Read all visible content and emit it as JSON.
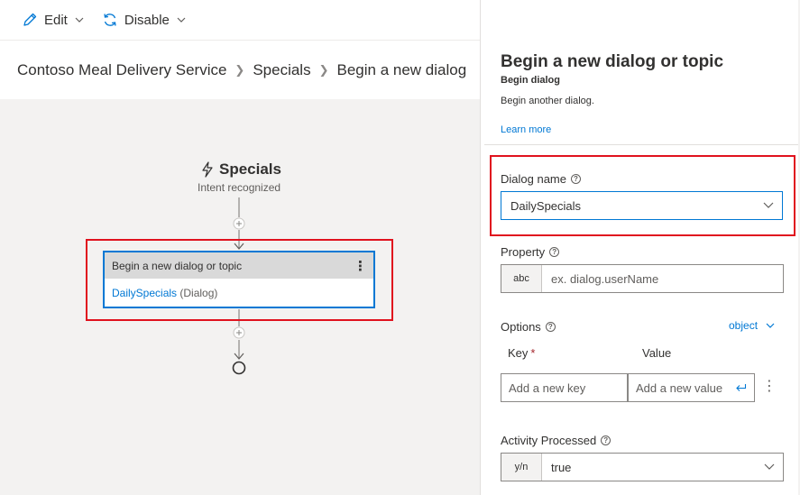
{
  "toolbar": {
    "edit_label": "Edit",
    "disable_label": "Disable"
  },
  "breadcrumb": [
    "Contoso Meal Delivery Service",
    "Specials",
    "Begin a new dialog"
  ],
  "canvas": {
    "trigger": {
      "title": "Specials",
      "subtitle": "Intent recognized"
    },
    "node": {
      "title": "Begin a new dialog or topic",
      "dialog_link": "DailySpecials",
      "dialog_suffix": "(Dialog)"
    },
    "add_step_icon": "plus-icon",
    "end_icon": "circle-icon"
  },
  "panel": {
    "title": "Begin a new dialog or topic",
    "subtitle": "Begin dialog",
    "description": "Begin another dialog.",
    "learn_more": "Learn more",
    "dialog_name": {
      "label": "Dialog name",
      "value": "DailySpecials"
    },
    "property": {
      "label": "Property",
      "prefix": "abc",
      "placeholder": "ex. dialog.userName"
    },
    "options": {
      "label": "Options",
      "type_link": "object",
      "key_header": "Key",
      "required_mark": "*",
      "value_header": "Value",
      "key_placeholder": "Add a new key",
      "value_placeholder": "Add a new value"
    },
    "activity_processed": {
      "label": "Activity Processed",
      "prefix": "y/n",
      "value": "true"
    }
  },
  "colors": {
    "accent": "#0078d4",
    "highlight": "#e0121e",
    "canvas_bg": "#f3f2f1"
  }
}
